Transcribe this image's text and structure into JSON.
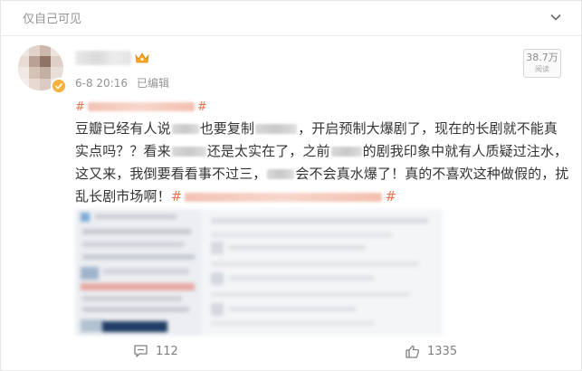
{
  "header": {
    "visibility_label": "仅自己可见",
    "more_icon": "chevron-down-icon"
  },
  "author": {
    "avatar_icon": "avatar",
    "vip_icon": "vip-crown-icon",
    "verified_icon": "verified-badge-icon"
  },
  "post": {
    "time": "6-8 20:16",
    "edited_label": "已编辑",
    "reads_count": "38.7万",
    "reads_label": "阅读",
    "topic_prefix": "#",
    "topic_suffix": "#",
    "text": {
      "p1": "豆瓣已经有人说",
      "p2": "也要复制",
      "p3": "，开启预制大爆剧了，现在的长剧就不能真实点吗？？看来",
      "p4": "还是太实在了，之前",
      "p5": "的剧我印象中就有人质疑过注水，这又来，我倒要看看事不过三，",
      "p6": "会不会真水爆了！真的不喜欢这种做假的，扰乱长剧市场啊！",
      "topic_open": "#",
      "topic_close": "#"
    }
  },
  "actions": {
    "comment_count": "112",
    "like_count": "1335",
    "comment_icon": "comment-icon",
    "like_icon": "thumbs-up-icon"
  },
  "colors": {
    "accent": "#eb7350",
    "meta_text": "#939393",
    "body_text": "#333333"
  }
}
